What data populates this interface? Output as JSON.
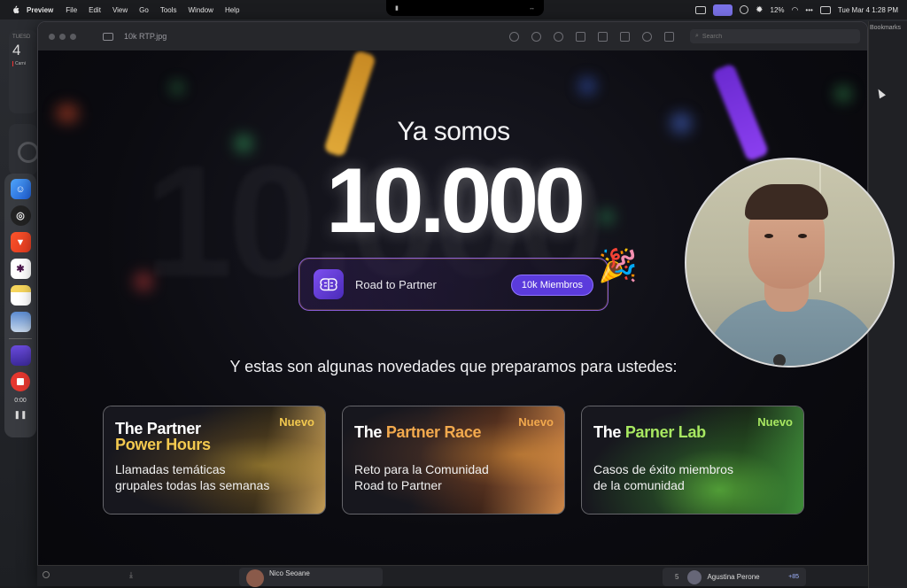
{
  "menubar": {
    "app": "Preview",
    "items": [
      "File",
      "Edit",
      "View",
      "Go",
      "Tools",
      "Window",
      "Help"
    ],
    "battery": "12%",
    "datetime": "Tue Mar 4  1:28 PM"
  },
  "desktop": {
    "calendar_widget": {
      "weekday": "TUESD",
      "day": "4",
      "event": "Carni"
    },
    "recording": {
      "time": "0:00"
    }
  },
  "window": {
    "title": "10k RTP.jpg",
    "search_placeholder": "Search",
    "bookmarks_label": "Bookmarks"
  },
  "slide": {
    "subtitle": "Ya somos",
    "number": "10.000",
    "pill": {
      "label": "Road to Partner",
      "badge": "10k Miembros"
    },
    "caption": "Y estas son algunas novedades que preparamos para ustedes:",
    "cards": [
      {
        "title_prefix": "The Partner",
        "title_highlight": "Power Hours",
        "badge": "Nuevo",
        "desc_line1": "Llamadas temáticas",
        "desc_line2": "grupales todas las semanas"
      },
      {
        "title_prefix": "The",
        "title_highlight": "Partner Race",
        "badge": "Nuevo",
        "desc_line1": "Reto para la Comunidad",
        "desc_line2": "Road to Partner"
      },
      {
        "title_prefix": "The",
        "title_highlight": "Parner Lab",
        "badge": "Nuevo",
        "desc_line1": "Casos de éxito miembros",
        "desc_line2": "de la comunidad"
      }
    ]
  },
  "call_bar": {
    "presenter_name": "Nico Seoane",
    "participant_count": "5",
    "participant_name": "Agustina Perone",
    "more_count": "+85"
  },
  "colors": {
    "accent_purple": "#5b3bdc",
    "highlight_gold": "#f3c94f",
    "highlight_orange": "#f2a94d",
    "highlight_green": "#a8e861",
    "record_red": "#e5372f"
  }
}
